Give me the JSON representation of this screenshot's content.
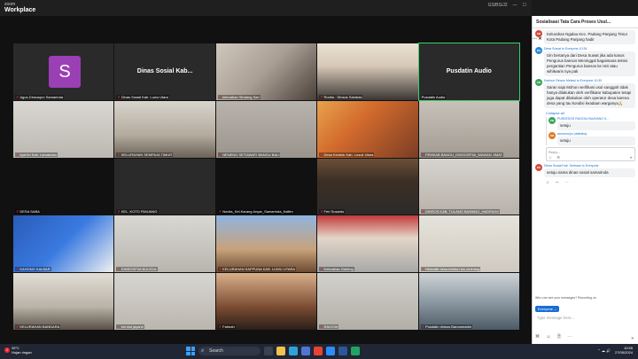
{
  "app": {
    "brand_top": "zoom",
    "brand_main": "Workplace",
    "status": "GS/BS/J2"
  },
  "tiles": [
    {
      "name": "Agus-Dinsospm Samarinda",
      "label_big": "",
      "avatar": "S"
    },
    {
      "name": "Dinas Sosial Kab. Luwu Utara",
      "label_big": "Dinas Sosial Kab..."
    },
    {
      "name": "kelurahan Sindang Sari"
    },
    {
      "name": "Rovita - Dinsos Sambas"
    },
    {
      "name": "Pusdatin Audio",
      "label_big": "Pusdatin Audio"
    },
    {
      "name": "bpd fm Kab. Lamandau"
    },
    {
      "name": "KELURAHAN SEMPAJA TIMUR"
    },
    {
      "name": "NENENG SETIAWATI BANGU BALI"
    },
    {
      "name": "Desa Kelotok Kab. Lusuk Utara"
    },
    {
      "name": "PEMKAB BANGU_DINSOSP3A_WAWAN JIMAT"
    },
    {
      "name": "DESA SABA"
    },
    {
      "name": "KEL. KOTO PANJANG"
    },
    {
      "name": "Novita_Kel.Karang Anyar_Samarinda_Kaltim"
    },
    {
      "name": "Feri Susanto"
    },
    {
      "name": "DINSOS KAB. TULANG BAWANG_HADRIANI"
    },
    {
      "name": "KAHONO KALBAR"
    },
    {
      "name": "DINSOSP3A BULEDA"
    },
    {
      "name": "KELURAHAN KAPPUNA KAB. LUWU UTARA"
    },
    {
      "name": "Kelurahan Galiring"
    },
    {
      "name": "Helmaliti desa babba nes cenhang"
    },
    {
      "name": "KELURAHAN BANDARA"
    },
    {
      "name": "esi dwi jayanti"
    },
    {
      "name": "Fatmah"
    },
    {
      "name": "RAVIOW"
    },
    {
      "name": "Pusdatin dinsos Barcamradin"
    }
  ],
  "chat": {
    "title": "Sosialisasi Tata Cara Proses Usul...",
    "messages": [
      {
        "initials": "KN",
        "color": "#d24b3a",
        "sender": "",
        "text": "Kelurahan Ngalau Kec. Padang Panjang Timur Kota Padang Panjang hadir"
      },
      {
        "initials": "DS",
        "color": "#2b8ad6",
        "sender": "Desa Suwat to Everyone 10:26",
        "text": "Izin bertanya dari Desa Suwat jika ada kasus Pengurus bansos Meninggal bagaimana teknis pergantian Pengurus bansos ke istri atau wihilwaris nya pak"
      },
      {
        "initials": "KD",
        "color": "#3aa55a",
        "sender": "Kantoor Dinsos Melawi to Everyone 10:30",
        "text": "Saran saja Mohon verifikasi usul sanggah tidak hanya dilakukan oleh verifikator kabupaten tetapi juga dapat dilakukan oleh operator desa karena desa yang tau kondisi keadaan warganya🙏"
      }
    ],
    "collapse_all": "Collapse all",
    "thread": [
      {
        "initials": "PB",
        "color": "#3aa55a",
        "sender": "PUSKESOS RANTAU BUAYANG K...",
        "text": "setuju"
      },
      {
        "initials": "KN",
        "color": "#e07a2a",
        "sender": "wonomulyo (dalhaha)",
        "text": "setuju"
      }
    ],
    "reply_placeholder": "Reply...",
    "last": {
      "initials": "DS",
      "color": "#d24b3a",
      "sender": "Dinas Sosial Kab. Serbaan to Everyone",
      "text": "setuju sama dinas sosial samarinda"
    },
    "who_can_see": "Who can see your messages? Recording on",
    "to_label": "Everyone ⌄",
    "input_placeholder": "Type message here..."
  },
  "taskbar": {
    "weather_temp": "39°C",
    "weather_desc": "Hujan ringan",
    "search_placeholder": "Search",
    "time": "10:55",
    "date": "27/05/2024"
  }
}
